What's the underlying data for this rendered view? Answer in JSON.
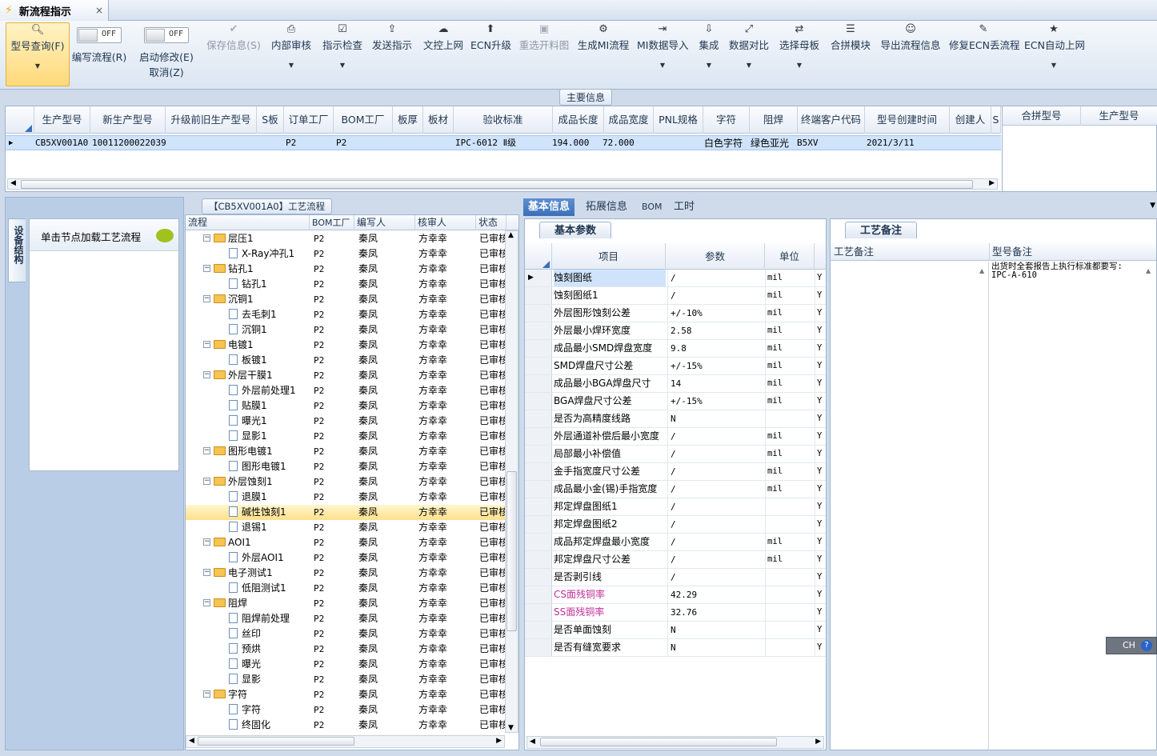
{
  "window": {
    "tab_title": "新流程指示",
    "close_glyph": "×"
  },
  "toolbar": {
    "query": {
      "label": "型号查询(F)",
      "icon": "search-icon"
    },
    "write_flow": {
      "state": "OFF",
      "label": "编写流程(R)"
    },
    "start_edit": {
      "state": "OFF",
      "label": "启动修改(E)",
      "label2": "取消(Z)"
    },
    "buttons": [
      {
        "label": "保存信息(S)",
        "icon": "✔"
      },
      {
        "label": "内部审核",
        "icon": "⎙"
      },
      {
        "label": "指示检查",
        "icon": "☑"
      },
      {
        "label": "发送指示",
        "icon": "⇪"
      },
      {
        "label": "文控上网",
        "icon": "☁"
      },
      {
        "label": "ECN升级",
        "icon": "⬆"
      },
      {
        "label": "重选开料图",
        "icon": "▣"
      },
      {
        "label": "生成MI流程",
        "icon": "⚙"
      },
      {
        "label": "MI数据导入",
        "icon": "⇥"
      },
      {
        "label": "集成",
        "icon": "⇩"
      },
      {
        "label": "数据对比",
        "icon": "⤢"
      },
      {
        "label": "选择母板",
        "icon": "⇄"
      },
      {
        "label": "合拼模块",
        "icon": "☰"
      },
      {
        "label": "导出流程信息",
        "icon": "☺"
      },
      {
        "label": "修复ECN丢流程",
        "icon": "✎"
      },
      {
        "label": "ECN自动上网",
        "icon": "★"
      }
    ]
  },
  "main_info": {
    "section_label": "主要信息",
    "columns": [
      "生产型号",
      "新生产型号",
      "升级前旧生产型号",
      "S板",
      "订单工厂",
      "BOM工厂",
      "板厚",
      "板材",
      "验收标准",
      "成品长度",
      "成品宽度",
      "PNL规格",
      "字符",
      "阻焊",
      "终端客户代码",
      "型号创建时间",
      "创建人",
      "S"
    ],
    "row": [
      "CB5XV001A0",
      "10011200022039",
      "",
      "",
      "P2",
      "P2",
      "",
      "",
      "IPC-6012 Ⅱ级",
      "194.000",
      "72.000",
      "",
      "白色字符",
      "绿色亚光",
      "B5XV",
      "2021/3/11",
      "",
      ""
    ],
    "side_columns": [
      "合拼型号",
      "生产型号"
    ]
  },
  "left": {
    "side_tab": "设备结构",
    "load_hint": "单击节点加载工艺流程"
  },
  "tree": {
    "title": "【CB5XV001A0】工艺流程",
    "columns": [
      "流程",
      "BOM工厂",
      "编写人",
      "核审人",
      "状态"
    ],
    "rows": [
      {
        "name": "层压1",
        "level": 0,
        "bom": "P2",
        "writer": "秦凤",
        "reviewer": "方幸幸",
        "status": "已审核"
      },
      {
        "name": "X-Ray冲孔1",
        "level": 1,
        "bom": "P2",
        "writer": "秦凤",
        "reviewer": "方幸幸",
        "status": "已审核"
      },
      {
        "name": "钻孔1",
        "level": 0,
        "bom": "P2",
        "writer": "秦凤",
        "reviewer": "方幸幸",
        "status": "已审核"
      },
      {
        "name": "钻孔1",
        "level": 1,
        "bom": "P2",
        "writer": "秦凤",
        "reviewer": "方幸幸",
        "status": "已审核"
      },
      {
        "name": "沉铜1",
        "level": 0,
        "bom": "P2",
        "writer": "秦凤",
        "reviewer": "方幸幸",
        "status": "已审核"
      },
      {
        "name": "去毛刺1",
        "level": 1,
        "bom": "P2",
        "writer": "秦凤",
        "reviewer": "方幸幸",
        "status": "已审核"
      },
      {
        "name": "沉铜1",
        "level": 1,
        "bom": "P2",
        "writer": "秦凤",
        "reviewer": "方幸幸",
        "status": "已审核"
      },
      {
        "name": "电镀1",
        "level": 0,
        "bom": "P2",
        "writer": "秦凤",
        "reviewer": "方幸幸",
        "status": "已审核"
      },
      {
        "name": "板镀1",
        "level": 1,
        "bom": "P2",
        "writer": "秦凤",
        "reviewer": "方幸幸",
        "status": "已审核"
      },
      {
        "name": "外层干膜1",
        "level": 0,
        "bom": "P2",
        "writer": "秦凤",
        "reviewer": "方幸幸",
        "status": "已审核"
      },
      {
        "name": "外层前处理1",
        "level": 1,
        "bom": "P2",
        "writer": "秦凤",
        "reviewer": "方幸幸",
        "status": "已审核"
      },
      {
        "name": "贴膜1",
        "level": 1,
        "bom": "P2",
        "writer": "秦凤",
        "reviewer": "方幸幸",
        "status": "已审核"
      },
      {
        "name": "曝光1",
        "level": 1,
        "bom": "P2",
        "writer": "秦凤",
        "reviewer": "方幸幸",
        "status": "已审核"
      },
      {
        "name": "显影1",
        "level": 1,
        "bom": "P2",
        "writer": "秦凤",
        "reviewer": "方幸幸",
        "status": "已审核"
      },
      {
        "name": "图形电镀1",
        "level": 0,
        "bom": "P2",
        "writer": "秦凤",
        "reviewer": "方幸幸",
        "status": "已审核"
      },
      {
        "name": "图形电镀1",
        "level": 1,
        "bom": "P2",
        "writer": "秦凤",
        "reviewer": "方幸幸",
        "status": "已审核"
      },
      {
        "name": "外层蚀刻1",
        "level": 0,
        "bom": "P2",
        "writer": "秦凤",
        "reviewer": "方幸幸",
        "status": "已审核"
      },
      {
        "name": "退膜1",
        "level": 1,
        "bom": "P2",
        "writer": "秦凤",
        "reviewer": "方幸幸",
        "status": "已审核"
      },
      {
        "name": "碱性蚀刻1",
        "level": 1,
        "bom": "P2",
        "writer": "秦凤",
        "reviewer": "方幸幸",
        "status": "已审核",
        "selected": true
      },
      {
        "name": "退锡1",
        "level": 1,
        "bom": "P2",
        "writer": "秦凤",
        "reviewer": "方幸幸",
        "status": "已审核"
      },
      {
        "name": "AOI1",
        "level": 0,
        "bom": "P2",
        "writer": "秦凤",
        "reviewer": "方幸幸",
        "status": "已审核"
      },
      {
        "name": "外层AOI1",
        "level": 1,
        "bom": "P2",
        "writer": "秦凤",
        "reviewer": "方幸幸",
        "status": "已审核"
      },
      {
        "name": "电子测试1",
        "level": 0,
        "bom": "P2",
        "writer": "秦凤",
        "reviewer": "方幸幸",
        "status": "已审核"
      },
      {
        "name": "低阻测试1",
        "level": 1,
        "bom": "P2",
        "writer": "秦凤",
        "reviewer": "方幸幸",
        "status": "已审核"
      },
      {
        "name": "阻焊",
        "level": 0,
        "bom": "P2",
        "writer": "秦凤",
        "reviewer": "方幸幸",
        "status": "已审核"
      },
      {
        "name": "阻焊前处理",
        "level": 1,
        "bom": "P2",
        "writer": "秦凤",
        "reviewer": "方幸幸",
        "status": "已审核"
      },
      {
        "name": "丝印",
        "level": 1,
        "bom": "P2",
        "writer": "秦凤",
        "reviewer": "方幸幸",
        "status": "已审核"
      },
      {
        "name": "预烘",
        "level": 1,
        "bom": "P2",
        "writer": "秦凤",
        "reviewer": "方幸幸",
        "status": "已审核"
      },
      {
        "name": "曝光",
        "level": 1,
        "bom": "P2",
        "writer": "秦凤",
        "reviewer": "方幸幸",
        "status": "已审核"
      },
      {
        "name": "显影",
        "level": 1,
        "bom": "P2",
        "writer": "秦凤",
        "reviewer": "方幸幸",
        "status": "已审核"
      },
      {
        "name": "字符",
        "level": 0,
        "bom": "P2",
        "writer": "秦凤",
        "reviewer": "方幸幸",
        "status": "已审核"
      },
      {
        "name": "字符",
        "level": 1,
        "bom": "P2",
        "writer": "秦凤",
        "reviewer": "方幸幸",
        "status": "已审核"
      },
      {
        "name": "终固化",
        "level": 1,
        "bom": "P2",
        "writer": "秦凤",
        "reviewer": "方幸幸",
        "status": "已审核"
      }
    ]
  },
  "detail_tabs": [
    "基本信息",
    "拓展信息",
    "BOM",
    "工时"
  ],
  "params": {
    "panel_tab": "基本参数",
    "columns": [
      "项目",
      "参数",
      "单位"
    ],
    "rows": [
      {
        "item": "蚀刻图纸",
        "param": "/",
        "unit": "mil",
        "flag": "Y"
      },
      {
        "item": "蚀刻图纸1",
        "param": "/",
        "unit": "mil",
        "flag": "Y"
      },
      {
        "item": "外层图形蚀刻公差",
        "param": "+/-10%",
        "unit": "mil",
        "flag": "Y"
      },
      {
        "item": "外层最小焊环宽度",
        "param": "2.58",
        "unit": "mil",
        "flag": "Y"
      },
      {
        "item": "成品最小SMD焊盘宽度",
        "param": "9.8",
        "unit": "mil",
        "flag": "Y"
      },
      {
        "item": "SMD焊盘尺寸公差",
        "param": "+/-15%",
        "unit": "mil",
        "flag": "Y"
      },
      {
        "item": "成品最小BGA焊盘尺寸",
        "param": "14",
        "unit": "mil",
        "flag": "Y"
      },
      {
        "item": "BGA焊盘尺寸公差",
        "param": "+/-15%",
        "unit": "mil",
        "flag": "Y"
      },
      {
        "item": "是否为高精度线路",
        "param": "N",
        "unit": "",
        "flag": "Y"
      },
      {
        "item": "外层通道补偿后最小宽度",
        "param": "/",
        "unit": "mil",
        "flag": "Y"
      },
      {
        "item": "局部最小补偿值",
        "param": "/",
        "unit": "mil",
        "flag": "Y"
      },
      {
        "item": "金手指宽度尺寸公差",
        "param": "/",
        "unit": "mil",
        "flag": "Y"
      },
      {
        "item": "成品最小金(锡)手指宽度",
        "param": "/",
        "unit": "mil",
        "flag": "Y"
      },
      {
        "item": "邦定焊盘图纸1",
        "param": "/",
        "unit": "",
        "flag": "Y"
      },
      {
        "item": "邦定焊盘图纸2",
        "param": "/",
        "unit": "",
        "flag": "Y"
      },
      {
        "item": "成品邦定焊盘最小宽度",
        "param": "/",
        "unit": "mil",
        "flag": "Y"
      },
      {
        "item": "邦定焊盘尺寸公差",
        "param": "/",
        "unit": "mil",
        "flag": "Y"
      },
      {
        "item": "是否剥引线",
        "param": "/",
        "unit": "",
        "flag": "Y"
      },
      {
        "item": "CS面残铜率",
        "param": "42.29",
        "unit": "",
        "flag": "Y",
        "pink": true
      },
      {
        "item": "SS面残铜率",
        "param": "32.76",
        "unit": "",
        "flag": "Y",
        "pink": true
      },
      {
        "item": "是否单面蚀刻",
        "param": "N",
        "unit": "",
        "flag": "Y"
      },
      {
        "item": "是否有缝宽要求",
        "param": "N",
        "unit": "",
        "flag": "Y"
      }
    ]
  },
  "notes": {
    "panel_tab": "工艺备注",
    "col_process": "工艺备注",
    "col_model": "型号备注",
    "model_note_line1": "出货时全套报告上执行标准都要写:",
    "model_note_line2": "IPC-A-610"
  },
  "ime": {
    "label": "CH",
    "help": "?"
  }
}
